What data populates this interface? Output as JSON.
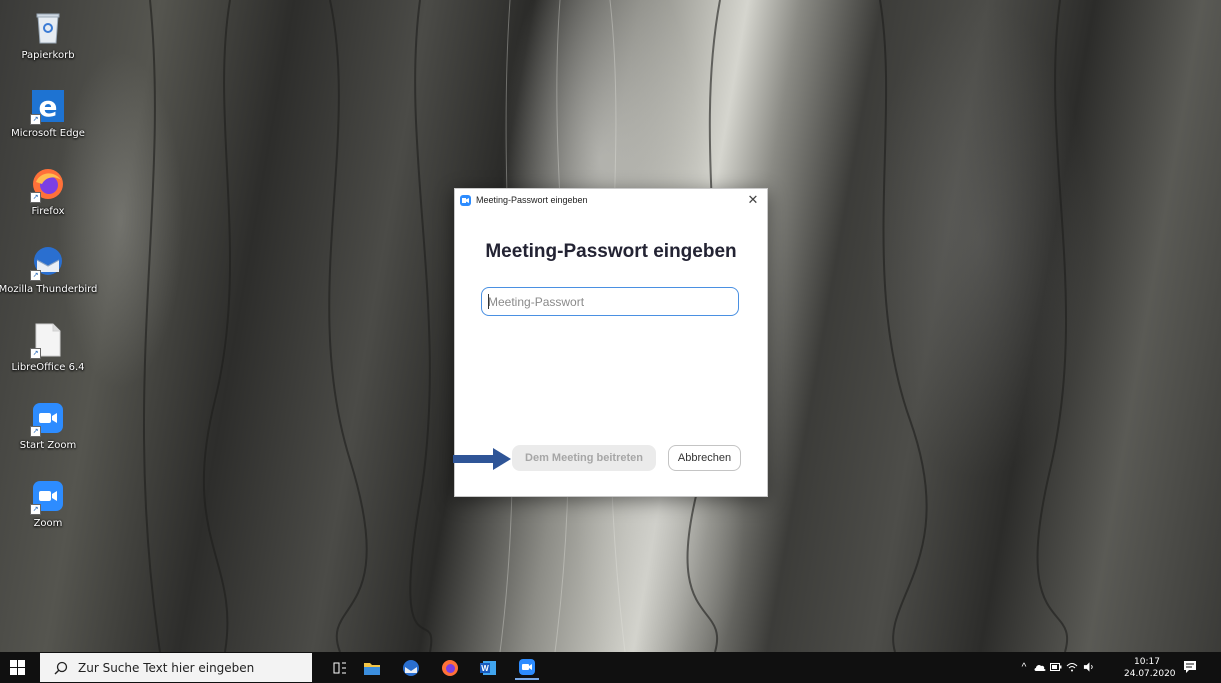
{
  "desktop": {
    "icons": [
      {
        "label": "Papierkorb",
        "icon": "recycle-bin-icon"
      },
      {
        "label": "Microsoft Edge",
        "icon": "edge-icon"
      },
      {
        "label": "Firefox",
        "icon": "firefox-icon"
      },
      {
        "label": "Mozilla Thunderbird",
        "icon": "thunderbird-icon"
      },
      {
        "label": "LibreOffice 6.4",
        "icon": "libreoffice-icon"
      },
      {
        "label": "Start Zoom",
        "icon": "zoom-icon"
      },
      {
        "label": "Zoom",
        "icon": "zoom-icon"
      }
    ]
  },
  "dialog": {
    "window_title": "Meeting-Passwort eingeben",
    "heading": "Meeting-Passwort eingeben",
    "password_placeholder": "Meeting-Passwort",
    "password_value": "",
    "join_label": "Dem Meeting beitreten",
    "cancel_label": "Abbrechen",
    "close_glyph": "✕"
  },
  "taskbar": {
    "search_placeholder": "Zur Suche Text hier eingeben",
    "apps": [
      "task-view-icon",
      "file-explorer-icon",
      "thunderbird-icon",
      "firefox-icon",
      "word-icon",
      "zoom-icon"
    ],
    "clock_time": "10:17",
    "clock_date": "24.07.2020"
  },
  "colors": {
    "zoom_blue": "#2d8cff",
    "input_focus": "#4a90e2",
    "arrow": "#2f5597",
    "taskbar": "#101010"
  }
}
